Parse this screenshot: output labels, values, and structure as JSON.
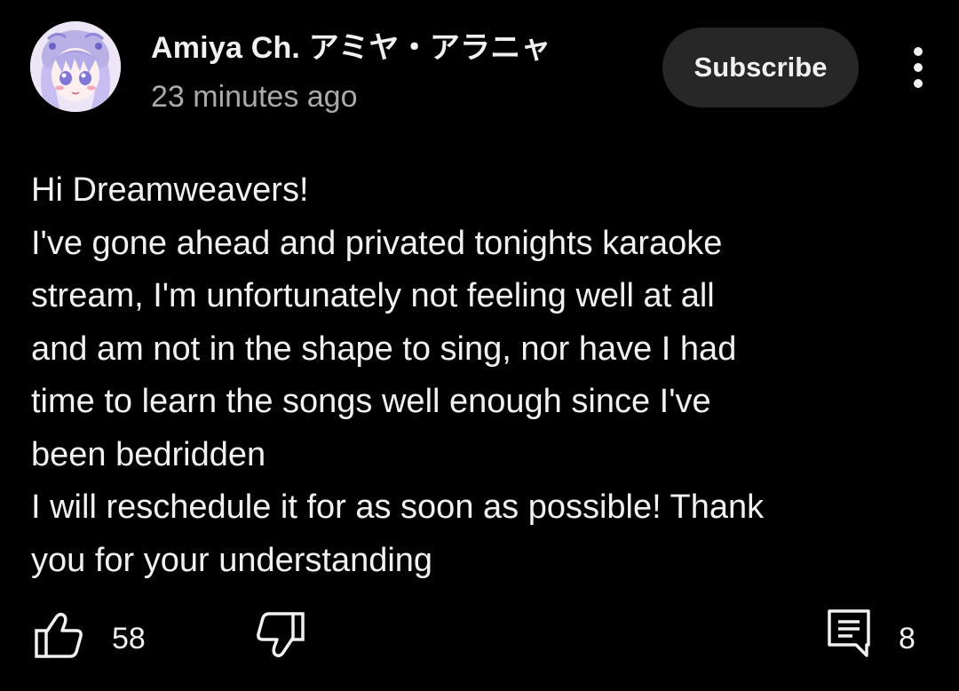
{
  "comment": {
    "author": "Amiya Ch. アミヤ・アラニャ",
    "time": "23 minutes ago",
    "subscribe_label": "Subscribe",
    "more_icon": "more-vert-icon",
    "lines": [
      "Hi Dreamweavers!",
      "I've gone ahead and privated tonights karaoke",
      "stream, I'm unfortunately not feeling well at all",
      "and am not in the shape to sing, nor have I had",
      "time to learn the songs well enough since I've",
      "been bedridden",
      "I will reschedule it for as soon as possible! Thank",
      "you for your understanding"
    ],
    "like_count": "58",
    "reply_count": "8"
  },
  "icons": {
    "like": "thumbs-up-icon",
    "dislike": "thumbs-down-icon",
    "reply": "comment-icon"
  },
  "colors": {
    "background": "#000000",
    "text": "#f1f1f1",
    "secondary_text": "#aaaaaa",
    "button_bg": "#272727"
  }
}
